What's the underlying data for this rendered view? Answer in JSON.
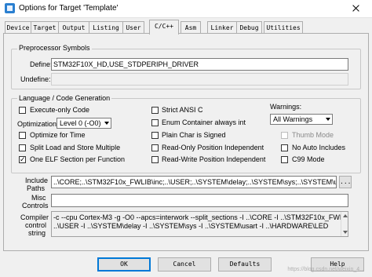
{
  "window": {
    "title": "Options for Target 'Template'"
  },
  "tabs": [
    "Device",
    "Target",
    "Output",
    "Listing",
    "User",
    "C/C++",
    "Asm",
    "Linker",
    "Debug",
    "Utilities"
  ],
  "preprocessor": {
    "legend": "Preprocessor Symbols",
    "define_label": "Define:",
    "define_value": "STM32F10X_HD,USE_STDPERIPH_DRIVER",
    "undefine_label": "Undefine:",
    "undefine_value": ""
  },
  "language": {
    "legend": "Language / Code Generation",
    "execute_only": {
      "label": "Execute-only Code",
      "checked": false
    },
    "optimization_label": "Optimization:",
    "optimization_value": "Level 0 (-O0)",
    "optimize_time": {
      "label": "Optimize for Time",
      "checked": false
    },
    "split_load": {
      "label": "Split Load and Store Multiple",
      "checked": false
    },
    "one_elf": {
      "label": "One ELF Section per Function",
      "checked": true
    },
    "strict_ansi": {
      "label": "Strict ANSI C",
      "checked": false
    },
    "enum_container": {
      "label": "Enum Container always int",
      "checked": false
    },
    "plain_char": {
      "label": "Plain Char is Signed",
      "checked": false
    },
    "ro_pi": {
      "label": "Read-Only Position Independent",
      "checked": false
    },
    "rw_pi": {
      "label": "Read-Write Position Independent",
      "checked": false
    },
    "warnings_label": "Warnings:",
    "warnings_value": "All Warnings",
    "thumb_mode": {
      "label": "Thumb Mode",
      "checked": false,
      "disabled": true
    },
    "no_auto_includes": {
      "label": "No Auto Includes",
      "checked": false
    },
    "c99_mode": {
      "label": "C99 Mode",
      "checked": false
    }
  },
  "include": {
    "label_line1": "Include",
    "label_line2": "Paths",
    "value": "..\\CORE;..\\STM32F10x_FWLIB\\inc;..\\USER;..\\SYSTEM\\delay;..\\SYSTEM\\sys;..\\SYSTEM\\usart;..\\",
    "browse_label": "..."
  },
  "misc": {
    "label_line1": "Misc",
    "label_line2": "Controls",
    "value": ""
  },
  "compiler": {
    "label_line1": "Compiler",
    "label_line2": "control",
    "label_line3": "string",
    "line1": "-c --cpu Cortex-M3 -g -O0 --apcs=interwork --split_sections -I ..\\CORE -I ..\\STM32F10x_FWLIB\\inc -I",
    "line2": "..\\USER -I ..\\SYSTEM\\delay -I ..\\SYSTEM\\sys -I ..\\SYSTEM\\usart -I ..\\HARDWARE\\LED"
  },
  "buttons": {
    "ok": "OK",
    "cancel": "Cancel",
    "defaults": "Defaults",
    "help": "Help"
  },
  "watermark": "https://blog.csdn.net/weixin_4..."
}
